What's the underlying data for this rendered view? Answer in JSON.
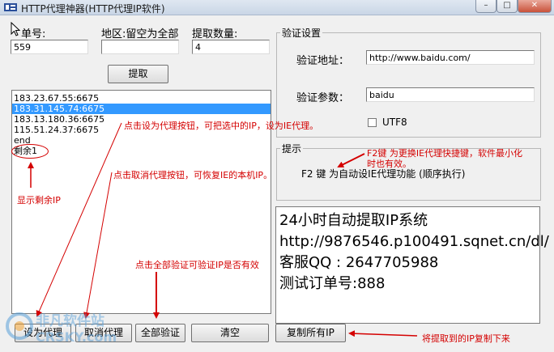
{
  "window": {
    "title": "HTTP代理神器(HTTP代理IP软件)",
    "minimize": "–",
    "maximize": "□",
    "close": "✕"
  },
  "fields": {
    "order_label": "单号:",
    "order_value": "559",
    "region_label": "地区:留空为全部",
    "region_value": "",
    "count_label": "提取数量:",
    "count_value": "4"
  },
  "fetch_button": "提取",
  "ip_list": [
    {
      "text": "183.23.67.55:6675",
      "selected": false
    },
    {
      "text": "183.31.145.74:6675",
      "selected": true
    },
    {
      "text": "183.13.180.36:6675",
      "selected": false
    },
    {
      "text": "115.51.24.37:6675",
      "selected": false
    },
    {
      "text": "end",
      "selected": false
    },
    {
      "text": "剩余1",
      "selected": false
    }
  ],
  "verify": {
    "group_title": "验证设置",
    "url_label": "验证地址：",
    "url_value": "http://www.baidu.com/",
    "param_label": "验证参数：",
    "param_value": "baidu",
    "utf8_label": "UTF8"
  },
  "hint": {
    "group_title": "提示",
    "text": "F2 键 为自动设IE代理功能  (顺序执行)"
  },
  "info_lines": [
    "24小时自动提取IP系统",
    "http://9876546.p100491.sqnet.cn/dl/",
    "客服QQ : 2647705988",
    "",
    "测试订单号:888"
  ],
  "buttons": {
    "set_proxy": "设为代理",
    "cancel_proxy": "取消代理",
    "verify_all": "全部验证",
    "clear": "清空",
    "copy_all": "复制所有IP"
  },
  "annotations": {
    "set_proxy_note": "点击设为代理按钮，可把选中的IP，设为IE代理。",
    "f2_note_1": "F2键 为更换IE代理快捷键，软件最小化",
    "f2_note_2": "时也有效。",
    "cancel_note": "点击取消代理按钮，可恢复IE的本机IP。",
    "remaining_note": "显示剩余IP",
    "verify_note": "点击全部验证可验证IP是否有效",
    "copy_note": "将提取到的IP复制下来"
  },
  "watermark": {
    "text_cn": "非凡软件站",
    "text_en": "CRSKY.com"
  },
  "colors": {
    "annotation": "#d40000",
    "selection": "#3399ff"
  }
}
